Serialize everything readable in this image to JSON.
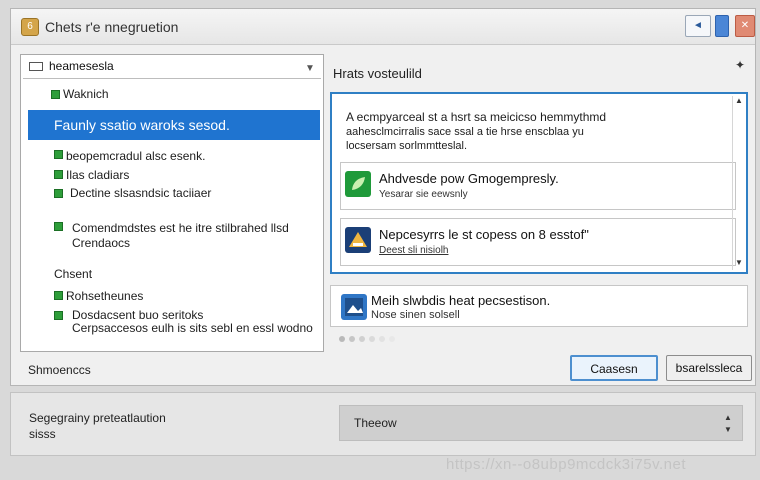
{
  "window": {
    "title": "Chets r'e nnegruetion",
    "app_icon_glyph": "6"
  },
  "titlebar": {
    "min_glyph": "◄",
    "close_glyph": "✕"
  },
  "left": {
    "combo": "heamesesla",
    "heading": "Waknich",
    "selected": "Faunly ssatio waroks sesod.",
    "items": [
      "beopemcradul alsc esenk.",
      "Ilas cladiars",
      "Dectine slsasndsic taciiaer",
      "Comendmdstes est he itre stilbrahed llsd",
      "Crendaocs"
    ],
    "section": "Chsent",
    "items2": [
      "Rohsetheunes",
      "Dosdacsent buo seritoks",
      "Cerpsaccesos eulh is sits sebl en essl wodno"
    ]
  },
  "right": {
    "title": "Hrats vosteulild",
    "pin_glyph": "✦",
    "info_lines": [
      "A ecmpyarceal st a hsrt sa meicicso hemmythmd",
      "aahesclmcirralis sace ssal a tie hrse enscblaa yu",
      "locsersam sorlmmtteslal."
    ],
    "cards": [
      {
        "title": "Ahdvesde pow Gmogempresly.",
        "sub": "Yesarar sie eewsnly"
      },
      {
        "title": "Nepcesyrrs le st copess on 8 esstof\"",
        "sub": "Deest sli nisiolh"
      }
    ],
    "card3": {
      "title": "Meih slwbdis heat pecsestison.",
      "sub": "Nose sinen solsell"
    }
  },
  "footer": {
    "status": "Shmoenccs",
    "primary_button": "Caasesn",
    "secondary_button": "bsarelssleca"
  },
  "bottom": {
    "line1": "Segegrainy preteatlaution",
    "line2": "sisss",
    "field": "Theeow"
  },
  "watermark": "https://xn--o8ubp9mcdck3i75v.net",
  "colors": {
    "accent": "#1f74d0",
    "panel_border": "#2f7fc4",
    "bullet": "#2e9e3a",
    "close": "#e08a73"
  },
  "icons": {
    "app": "app-icon",
    "pin": "pin-icon",
    "card1": "leaf-app-icon",
    "card2": "triangle-app-icon",
    "card3": "photo-app-icon"
  }
}
